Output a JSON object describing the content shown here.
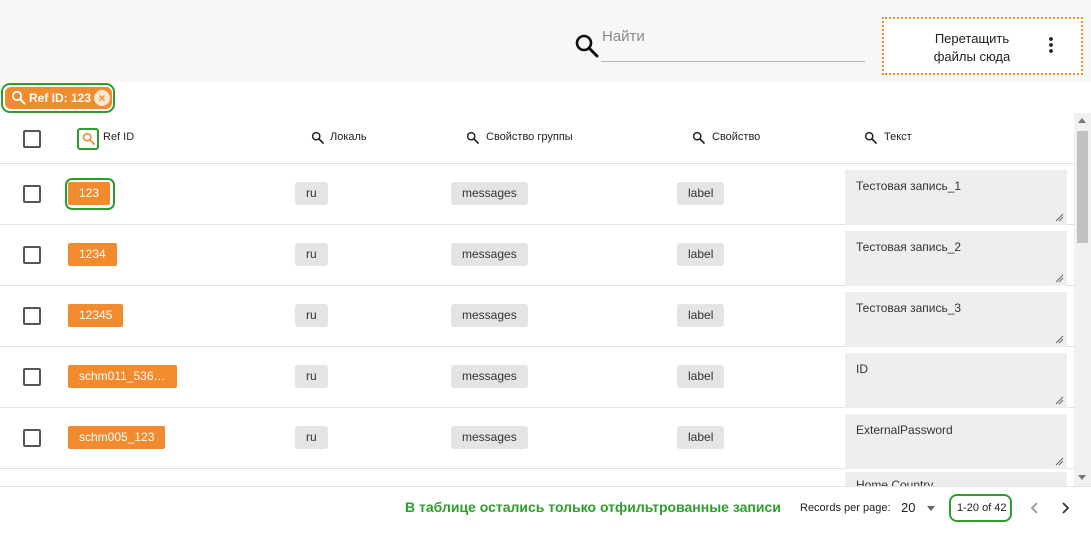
{
  "search": {
    "placeholder": "Найти",
    "icon": "search-icon"
  },
  "dropzone": {
    "label": "Перетащить\nфайлы сюда",
    "menu_icon": "more-vert-icon",
    "border_color": "#f28a2e"
  },
  "filter_chip": {
    "label": "Ref ID: 123",
    "close_icon": "close-icon"
  },
  "table": {
    "columns": [
      {
        "label": "Ref ID",
        "icon": "search-icon"
      },
      {
        "label": "Локаль",
        "icon": "search-icon"
      },
      {
        "label": "Свойство группы",
        "icon": "search-icon"
      },
      {
        "label": "Свойство",
        "icon": "search-icon"
      },
      {
        "label": "Текст",
        "icon": "search-icon"
      }
    ],
    "rows": [
      {
        "ref_id": "123",
        "locale": "ru",
        "group": "messages",
        "property": "label",
        "text": "Тестовая запись_1"
      },
      {
        "ref_id": "1234",
        "locale": "ru",
        "group": "messages",
        "property": "label",
        "text": "Тестовая запись_2"
      },
      {
        "ref_id": "12345",
        "locale": "ru",
        "group": "messages",
        "property": "label",
        "text": "Тестовая запись_3"
      },
      {
        "ref_id": "schm011_536…",
        "locale": "ru",
        "group": "messages",
        "property": "label",
        "text": "ID"
      },
      {
        "ref_id": "schm005_123",
        "locale": "ru",
        "group": "messages",
        "property": "label",
        "text": "ExternalPassword"
      }
    ],
    "partial_row_text": "Home Country"
  },
  "footer": {
    "note": "В таблице остались только отфильтрованные записи",
    "records_per_page_label": "Records per page:",
    "records_per_page": "20",
    "range": "1-20 of 42"
  },
  "colors": {
    "accent": "#f28a2e",
    "highlight": "#2e9d2e",
    "tag_bg": "#e4e4e4"
  }
}
